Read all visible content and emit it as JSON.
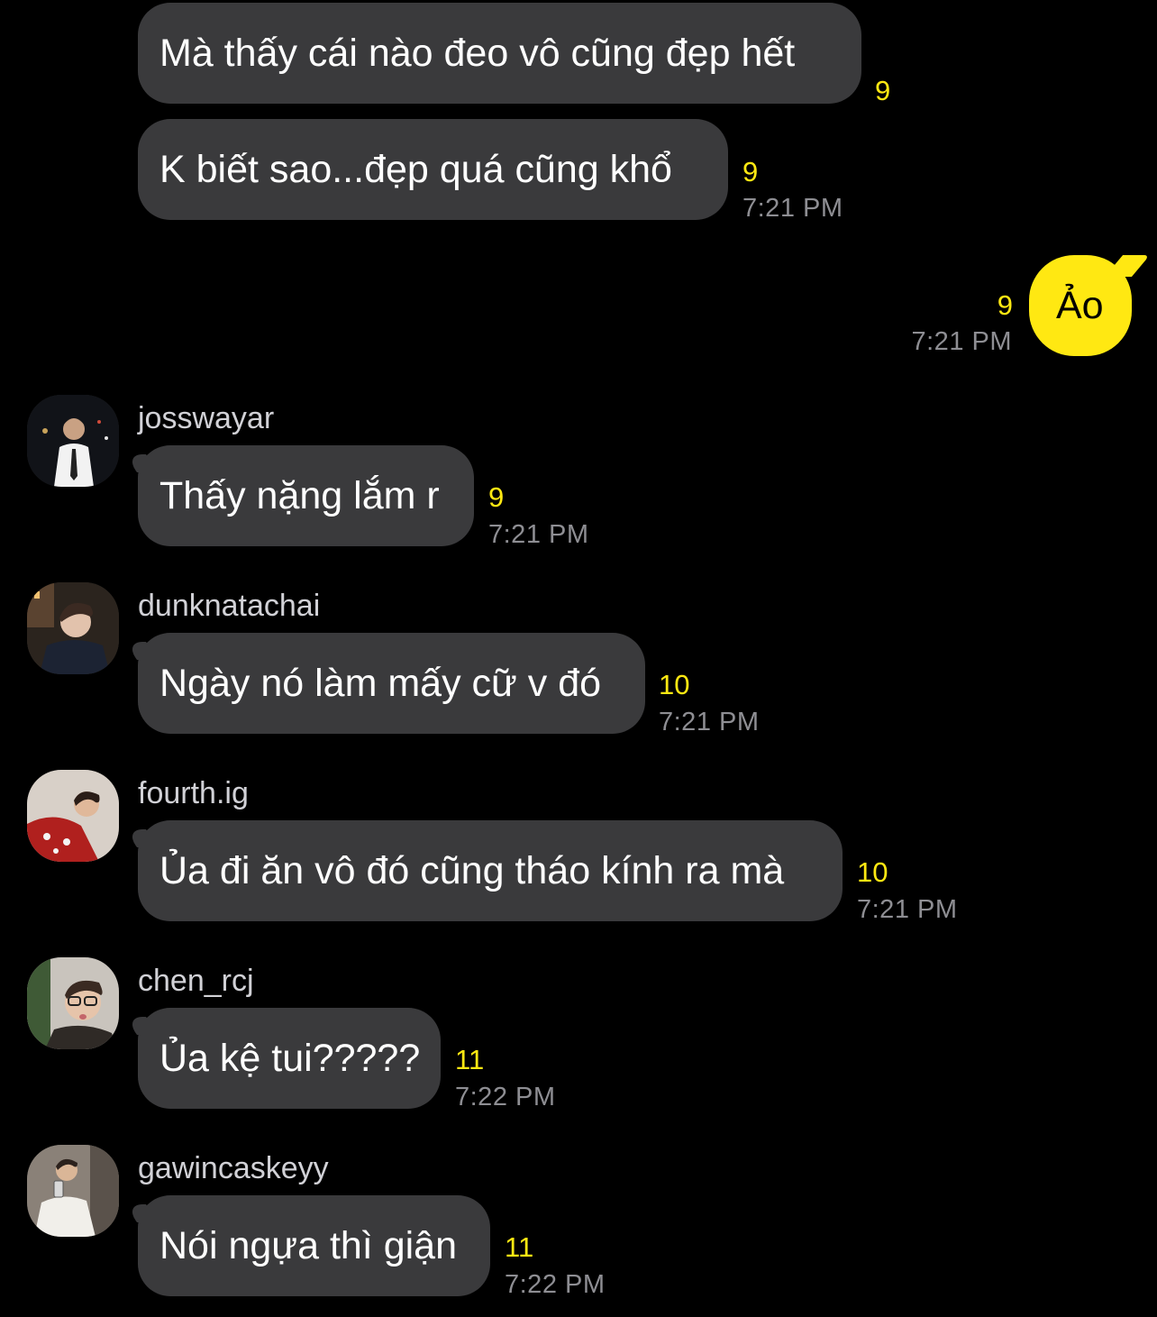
{
  "messages": [
    {
      "id": "m1",
      "text": "Mà thấy cái nào đeo vô cũng đẹp hết",
      "unread": "9",
      "time": ""
    },
    {
      "id": "m2",
      "text": "K biết sao...đẹp quá cũng khổ",
      "unread": "9",
      "time": "7:21 PM"
    },
    {
      "id": "m3",
      "text": "Ảo",
      "unread": "9",
      "time": "7:21 PM",
      "sender": "me"
    },
    {
      "id": "m4",
      "username": "josswayar",
      "text": "Thấy nặng lắm r",
      "unread": "9",
      "time": "7:21 PM"
    },
    {
      "id": "m5",
      "username": "dunknatachai",
      "text": "Ngày nó làm mấy cữ v đó",
      "unread": "10",
      "time": "7:21 PM"
    },
    {
      "id": "m6",
      "username": "fourth.ig",
      "text": "Ủa đi ăn vô đó cũng tháo kính ra mà",
      "unread": "10",
      "time": "7:21 PM"
    },
    {
      "id": "m7",
      "username": "chen_rcj",
      "text": "Ủa kệ tui?????",
      "unread": "11",
      "time": "7:22 PM"
    },
    {
      "id": "m8",
      "username": "gawincaskeyy",
      "text": "Nói ngựa thì giận",
      "unread": "11",
      "time": "7:22 PM"
    }
  ],
  "colors": {
    "background": "#000000",
    "incoming_bubble": "#3a3a3c",
    "outgoing_bubble": "#ffe812",
    "unread_count": "#ffe812",
    "timestamp": "#8e8e93"
  },
  "icons": [
    "avatar-josswayar",
    "avatar-dunknatachai",
    "avatar-fourth-ig",
    "avatar-chen-rcj",
    "avatar-gawincaskeyy"
  ]
}
